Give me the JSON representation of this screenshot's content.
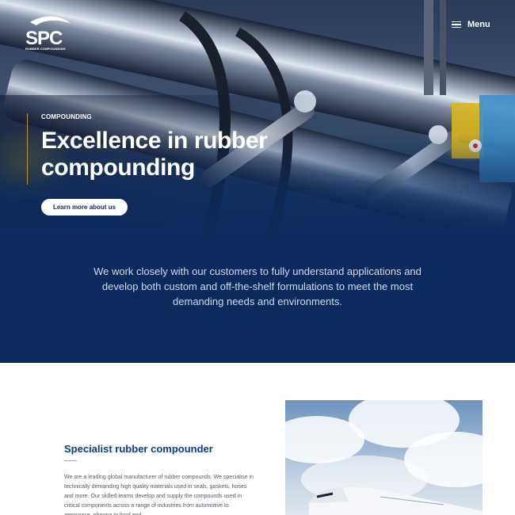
{
  "header": {
    "logo_text": "SPC",
    "logo_subtext": "RUBBER COMPOUNDING",
    "menu_label": "Menu"
  },
  "hero": {
    "eyebrow": "COMPOUNDING",
    "title": "Excellence in rubber compounding",
    "button_label": "Learn more about us"
  },
  "intro": {
    "text": "We work closely with our customers to fully understand applications and develop both custom and off-the-shelf formulations to meet the most demanding needs and environments."
  },
  "about": {
    "title": "Specialist rubber compounder",
    "body": "We are a leading global manufacturer of rubber compounds. We specialise in technically demanding high quality materials used in seals, gaskets, hoses and more. Our skilled teams develop and supply the compounds used in critical components across a range of industries from automotive to aerospace, pharma to food and"
  },
  "colors": {
    "navy": "#0b2a5e",
    "title_blue": "#0b3c88",
    "accent_orange": "#d89a3a"
  },
  "icons": [
    "menu-icon",
    "spc-logo"
  ]
}
